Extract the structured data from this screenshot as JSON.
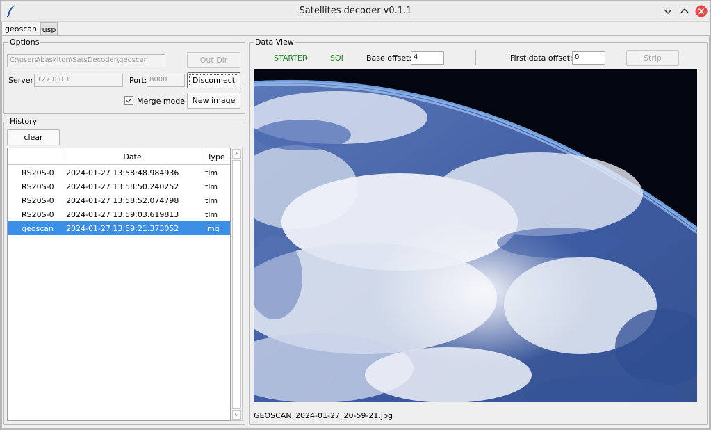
{
  "window": {
    "title": "Satellites decoder v0.1.1"
  },
  "tabs": [
    {
      "label": "geoscan",
      "active": true
    },
    {
      "label": "usp",
      "active": false
    }
  ],
  "options": {
    "title": "Options",
    "out_dir_path": "C:\\users\\baskiton\\SatsDecoder\\geoscan",
    "out_dir_button": "Out Dir",
    "server_label": "Server:",
    "server_value": "127.0.0.1",
    "port_label": "Port:",
    "port_value": "8000",
    "connect_button": "Disconnect",
    "merge_mode_label": "Merge mode",
    "merge_mode_checked": true,
    "new_image_button": "New image"
  },
  "history": {
    "title": "History",
    "clear_button": "clear",
    "columns": [
      "",
      "Date",
      "Type"
    ],
    "rows": [
      {
        "name": "RS20S-0",
        "date": "2024-01-27 13:58:48.984936",
        "type": "tlm",
        "selected": false
      },
      {
        "name": "RS20S-0",
        "date": "2024-01-27 13:58:50.240252",
        "type": "tlm",
        "selected": false
      },
      {
        "name": "RS20S-0",
        "date": "2024-01-27 13:58:52.074798",
        "type": "tlm",
        "selected": false
      },
      {
        "name": "RS20S-0",
        "date": "2024-01-27 13:59:03.619813",
        "type": "tlm",
        "selected": false
      },
      {
        "name": "geoscan",
        "date": "2024-01-27 13:59:21.373052",
        "type": "img",
        "selected": true
      }
    ]
  },
  "data_view": {
    "title": "Data View",
    "status_starter": "STARTER",
    "status_soi": "SOI",
    "status_color": "#1a8a1a",
    "base_offset_label": "Base offset:",
    "base_offset_value": "4",
    "first_data_offset_label": "First data offset:",
    "first_data_offset_value": "0",
    "strip_button": "Strip",
    "image_filename": "GEOSCAN_2024-01-27_20-59-21.jpg"
  },
  "colors": {
    "selection": "#3b8fe6",
    "close_button": "#e04a4a"
  }
}
